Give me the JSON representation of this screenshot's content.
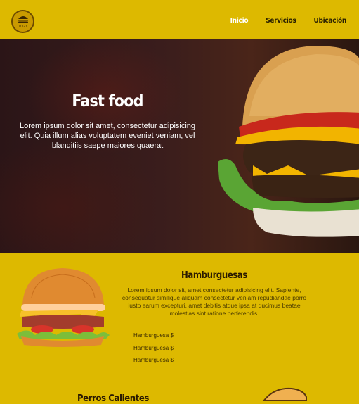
{
  "navbar": {
    "logo_text": "LOGO",
    "links": [
      "Inicio",
      "Servicios",
      "Ubicación"
    ]
  },
  "hero": {
    "title": "Fast food",
    "text": "Lorem ipsum dolor sit amet, consectetur adipisicing elit. Quia illum alias voluptatem eveniet veniam, vel blanditiis saepe maiores quaerat"
  },
  "hamburguesas": {
    "title": "Hamburguesas",
    "text": "Lorem ipsum dolor sit, amet consectetur adipisicing elit. Sapiente, consequatur similique aliquam consectetur veniam repudiandae porro iusto earum excepturi, amet debitis atque ipsa at ducimus beatae molestias sint ratione perferendis.",
    "items": [
      "Hamburguesa $",
      "Hamburguesa $",
      "Hamburguesa $"
    ]
  },
  "perros": {
    "title": "Perros Calientes"
  },
  "colors": {
    "primary": "#ddb900",
    "active_link": "#ffffff"
  }
}
